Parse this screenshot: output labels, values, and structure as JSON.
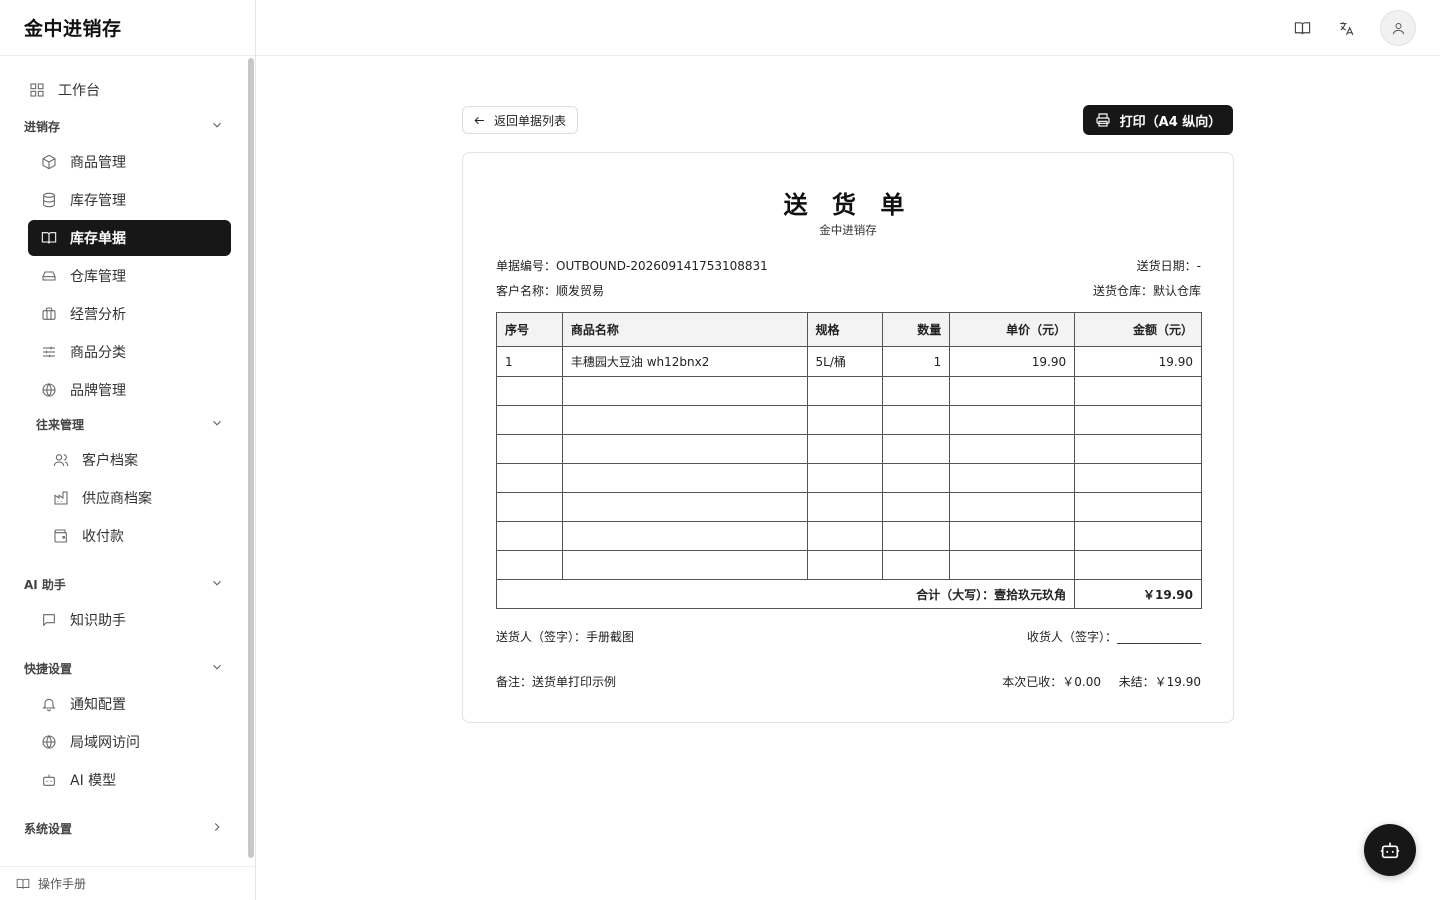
{
  "app": {
    "title": "金中进销存"
  },
  "sidebar": {
    "workbench": "工作台",
    "groups": {
      "inventory": {
        "label": "进销存",
        "items": [
          "商品管理",
          "库存管理",
          "库存单据",
          "仓库管理",
          "经营分析",
          "商品分类",
          "品牌管理"
        ]
      },
      "partners": {
        "label": "往来管理",
        "items": [
          "客户档案",
          "供应商档案",
          "收付款"
        ]
      },
      "ai": {
        "label": "AI 助手",
        "items": [
          "知识助手"
        ]
      },
      "quick": {
        "label": "快捷设置",
        "items": [
          "通知配置",
          "局域网访问",
          "AI 模型"
        ]
      },
      "system": {
        "label": "系统设置"
      }
    },
    "active_item": "库存单据",
    "manual": "操作手册"
  },
  "toolbar": {
    "back_label": "返回单据列表",
    "print_label": "打印（A4 纵向）"
  },
  "document": {
    "title": "送 货 单",
    "company": "金中进销存",
    "order_no": "单据编号：OUTBOUND-202609141753108831",
    "delivery_date": "送货日期：-",
    "customer": "客户名称：顺发贸易",
    "warehouse": "送货仓库：默认仓库",
    "columns": [
      "序号",
      "商品名称",
      "规格",
      "数量",
      "单价（元）",
      "金额（元）"
    ],
    "rows": [
      [
        "1",
        "丰穗园大豆油 wh12bnx2",
        "5L/桶",
        "1",
        "19.90",
        "19.90"
      ]
    ],
    "total_label": "合计（大写）：壹拾玖元玖角",
    "total_value": "￥19.90",
    "sender": "送货人（签字）：手册截图",
    "receiver": "收货人（签字）：______________",
    "remark": "备注：送货单打印示例",
    "received": "本次已收：￥0.00",
    "outstanding": "未结：￥19.90"
  },
  "colors": {
    "primary": "#171717",
    "border": "#e5e5e5"
  }
}
